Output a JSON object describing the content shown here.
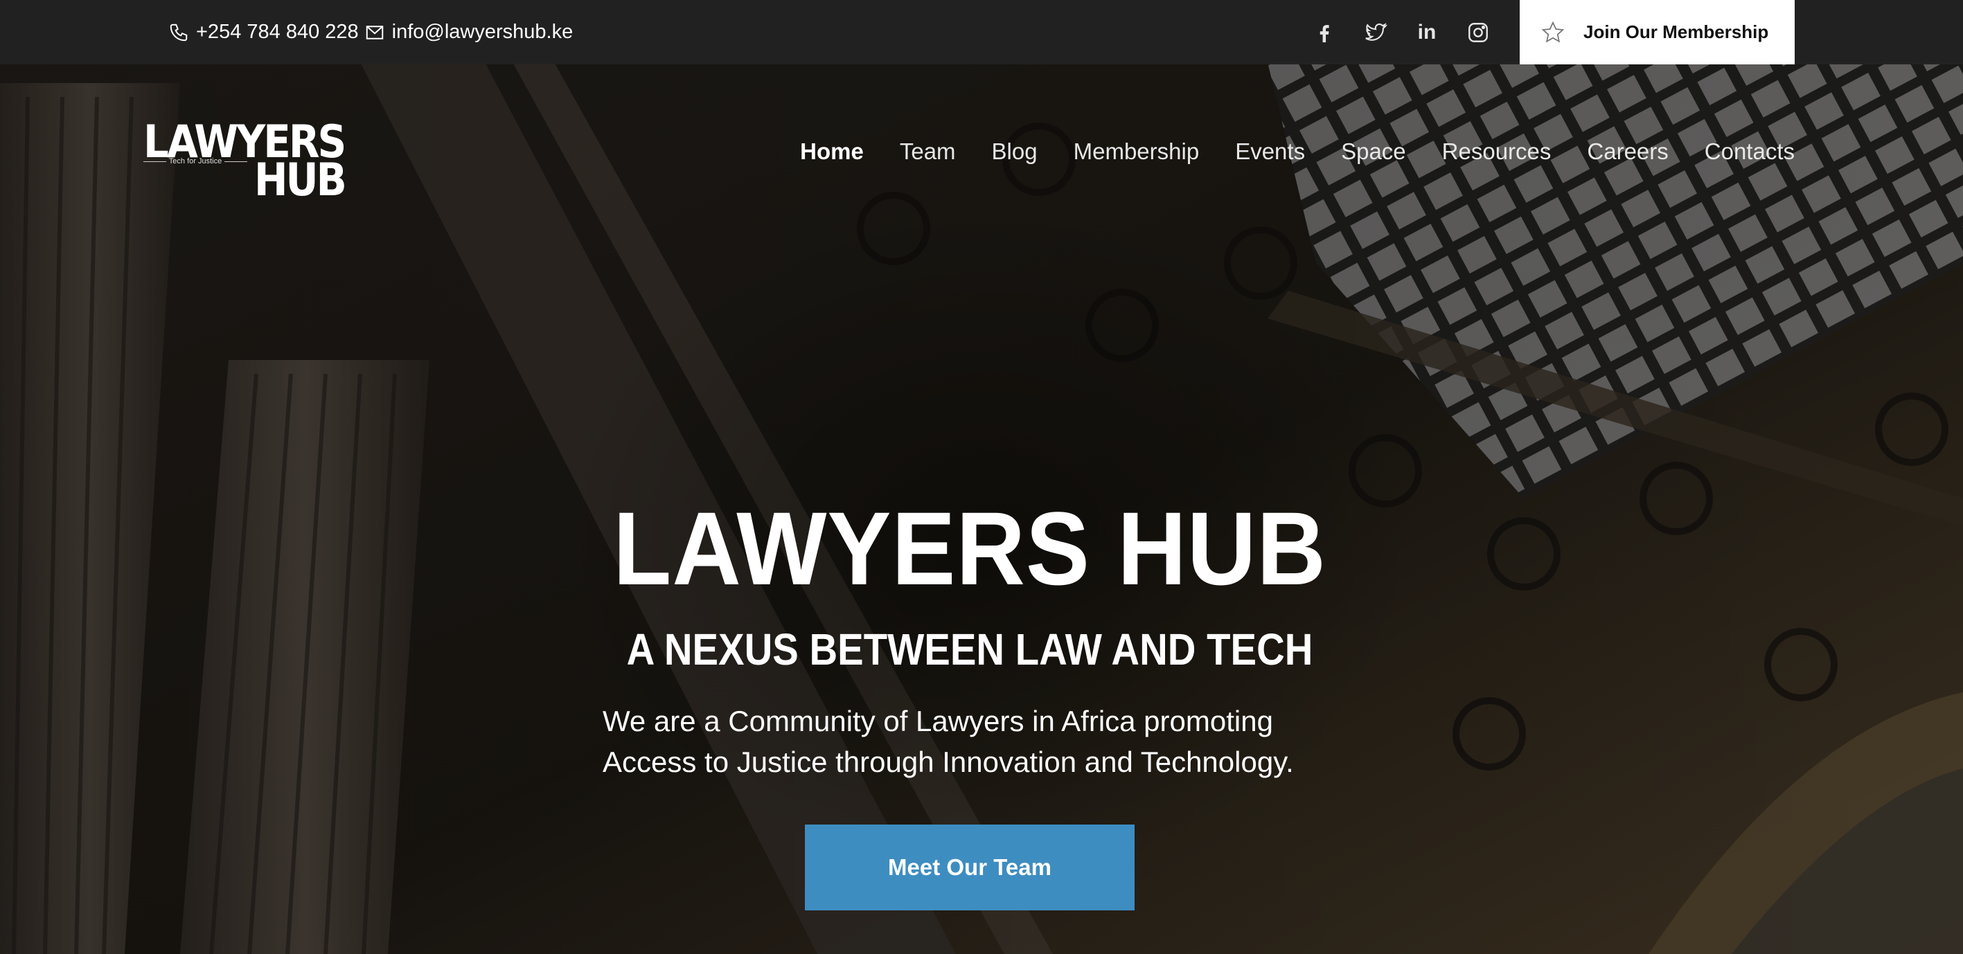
{
  "topbar": {
    "phone": "+254 784 840 228",
    "email": "info@lawyershub.ke",
    "social": [
      {
        "icon": "facebook-icon"
      },
      {
        "icon": "twitter-icon"
      },
      {
        "icon": "linkedin-icon",
        "glyph": "in"
      },
      {
        "icon": "instagram-icon"
      }
    ],
    "join_label": "Join Our Membership"
  },
  "logo": {
    "line1": "LAWYERS",
    "tagline": "Tech for Justice",
    "line2": "HUB"
  },
  "nav": {
    "items": [
      "Home",
      "Team",
      "Blog",
      "Membership",
      "Events",
      "Space",
      "Resources",
      "Careers",
      "Contacts"
    ],
    "active": "Home"
  },
  "hero": {
    "title": "LAWYERS HUB",
    "subtitle": "A NEXUS BETWEEN LAW AND TECH",
    "description": "We are a Community of Lawyers in Africa promoting Access to Justice through Innovation and Technology.",
    "cta_label": "Meet Our Team"
  },
  "colors": {
    "topbar_bg": "#222222",
    "cta_bg": "#3e8dc1",
    "text": "#ffffff"
  }
}
